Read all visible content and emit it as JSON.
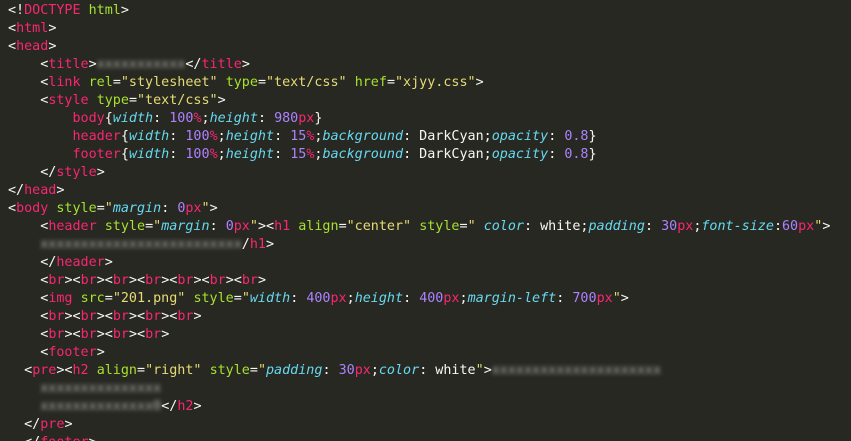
{
  "lines": [
    [
      {
        "t": "<!",
        "c": "punct"
      },
      {
        "t": "DOCTYPE",
        "c": "tag"
      },
      {
        "t": " ",
        "c": "text"
      },
      {
        "t": "html",
        "c": "attr"
      },
      {
        "t": ">",
        "c": "punct"
      }
    ],
    [
      {
        "t": "<",
        "c": "punct"
      },
      {
        "t": "html",
        "c": "tag"
      },
      {
        "t": ">",
        "c": "punct"
      }
    ],
    [
      {
        "t": "<",
        "c": "punct"
      },
      {
        "t": "head",
        "c": "tag"
      },
      {
        "t": ">",
        "c": "punct"
      }
    ],
    [
      {
        "t": "    <",
        "c": "punct"
      },
      {
        "t": "title",
        "c": "tag"
      },
      {
        "t": ">",
        "c": "punct"
      },
      {
        "t": "xxxxxxxxxxx",
        "c": "blur"
      },
      {
        "t": "</",
        "c": "punct"
      },
      {
        "t": "title",
        "c": "tag"
      },
      {
        "t": ">",
        "c": "punct"
      }
    ],
    [
      {
        "t": "    <",
        "c": "punct"
      },
      {
        "t": "link",
        "c": "tag"
      },
      {
        "t": " ",
        "c": "text"
      },
      {
        "t": "rel",
        "c": "attr"
      },
      {
        "t": "=",
        "c": "punct"
      },
      {
        "t": "\"stylesheet\"",
        "c": "string"
      },
      {
        "t": " ",
        "c": "text"
      },
      {
        "t": "type",
        "c": "attr"
      },
      {
        "t": "=",
        "c": "punct"
      },
      {
        "t": "\"text/css\"",
        "c": "string"
      },
      {
        "t": " ",
        "c": "text"
      },
      {
        "t": "href",
        "c": "attr"
      },
      {
        "t": "=",
        "c": "punct"
      },
      {
        "t": "\"xjyy.css\"",
        "c": "string"
      },
      {
        "t": ">",
        "c": "punct"
      }
    ],
    [
      {
        "t": "    <",
        "c": "punct"
      },
      {
        "t": "style",
        "c": "tag"
      },
      {
        "t": " ",
        "c": "text"
      },
      {
        "t": "type",
        "c": "attr"
      },
      {
        "t": "=",
        "c": "punct"
      },
      {
        "t": "\"text/css\"",
        "c": "string"
      },
      {
        "t": ">",
        "c": "punct"
      }
    ],
    [
      {
        "t": "        ",
        "c": "text"
      },
      {
        "t": "body",
        "c": "tag"
      },
      {
        "t": "{",
        "c": "punct"
      },
      {
        "t": "width",
        "c": "prop"
      },
      {
        "t": ": ",
        "c": "punct"
      },
      {
        "t": "100",
        "c": "num"
      },
      {
        "t": "%",
        "c": "unit"
      },
      {
        "t": ";",
        "c": "punct"
      },
      {
        "t": "height",
        "c": "prop"
      },
      {
        "t": ": ",
        "c": "punct"
      },
      {
        "t": "980",
        "c": "num"
      },
      {
        "t": "px",
        "c": "unit"
      },
      {
        "t": "}",
        "c": "punct"
      }
    ],
    [
      {
        "t": "        ",
        "c": "text"
      },
      {
        "t": "header",
        "c": "tag"
      },
      {
        "t": "{",
        "c": "punct"
      },
      {
        "t": "width",
        "c": "prop"
      },
      {
        "t": ": ",
        "c": "punct"
      },
      {
        "t": "100",
        "c": "num"
      },
      {
        "t": "%",
        "c": "unit"
      },
      {
        "t": ";",
        "c": "punct"
      },
      {
        "t": "height",
        "c": "prop"
      },
      {
        "t": ": ",
        "c": "punct"
      },
      {
        "t": "15",
        "c": "num"
      },
      {
        "t": "%",
        "c": "unit"
      },
      {
        "t": ";",
        "c": "punct"
      },
      {
        "t": "background",
        "c": "prop"
      },
      {
        "t": ": DarkCyan;",
        "c": "punct"
      },
      {
        "t": "opacity",
        "c": "prop"
      },
      {
        "t": ": ",
        "c": "punct"
      },
      {
        "t": "0.8",
        "c": "num"
      },
      {
        "t": "}",
        "c": "punct"
      }
    ],
    [
      {
        "t": "        ",
        "c": "text"
      },
      {
        "t": "footer",
        "c": "tag"
      },
      {
        "t": "{",
        "c": "punct"
      },
      {
        "t": "width",
        "c": "prop"
      },
      {
        "t": ": ",
        "c": "punct"
      },
      {
        "t": "100",
        "c": "num"
      },
      {
        "t": "%",
        "c": "unit"
      },
      {
        "t": ";",
        "c": "punct"
      },
      {
        "t": "height",
        "c": "prop"
      },
      {
        "t": ": ",
        "c": "punct"
      },
      {
        "t": "15",
        "c": "num"
      },
      {
        "t": "%",
        "c": "unit"
      },
      {
        "t": ";",
        "c": "punct"
      },
      {
        "t": "background",
        "c": "prop"
      },
      {
        "t": ": DarkCyan;",
        "c": "punct"
      },
      {
        "t": "opacity",
        "c": "prop"
      },
      {
        "t": ": ",
        "c": "punct"
      },
      {
        "t": "0.8",
        "c": "num"
      },
      {
        "t": "}",
        "c": "punct"
      }
    ],
    [
      {
        "t": "    </",
        "c": "punct"
      },
      {
        "t": "style",
        "c": "tag"
      },
      {
        "t": ">",
        "c": "punct"
      }
    ],
    [
      {
        "t": "</",
        "c": "punct"
      },
      {
        "t": "head",
        "c": "tag"
      },
      {
        "t": ">",
        "c": "punct"
      }
    ],
    [
      {
        "t": "<",
        "c": "punct"
      },
      {
        "t": "body",
        "c": "tag"
      },
      {
        "t": " ",
        "c": "text"
      },
      {
        "t": "style",
        "c": "attr"
      },
      {
        "t": "=",
        "c": "punct"
      },
      {
        "t": "\"",
        "c": "string"
      },
      {
        "t": "margin",
        "c": "prop"
      },
      {
        "t": ": ",
        "c": "punct"
      },
      {
        "t": "0",
        "c": "num"
      },
      {
        "t": "px",
        "c": "unit"
      },
      {
        "t": "\"",
        "c": "string"
      },
      {
        "t": ">",
        "c": "punct"
      }
    ],
    [
      {
        "t": "    <",
        "c": "punct"
      },
      {
        "t": "header",
        "c": "tag"
      },
      {
        "t": " ",
        "c": "text"
      },
      {
        "t": "style",
        "c": "attr"
      },
      {
        "t": "=",
        "c": "punct"
      },
      {
        "t": "\"",
        "c": "string"
      },
      {
        "t": "margin",
        "c": "prop"
      },
      {
        "t": ": ",
        "c": "punct"
      },
      {
        "t": "0",
        "c": "num"
      },
      {
        "t": "px",
        "c": "unit"
      },
      {
        "t": "\"",
        "c": "string"
      },
      {
        "t": "><",
        "c": "punct"
      },
      {
        "t": "h1",
        "c": "tag"
      },
      {
        "t": " ",
        "c": "text"
      },
      {
        "t": "align",
        "c": "attr"
      },
      {
        "t": "=",
        "c": "punct"
      },
      {
        "t": "\"center\"",
        "c": "string"
      },
      {
        "t": " ",
        "c": "text"
      },
      {
        "t": "style",
        "c": "attr"
      },
      {
        "t": "=",
        "c": "punct"
      },
      {
        "t": "\" ",
        "c": "string"
      },
      {
        "t": "color",
        "c": "prop"
      },
      {
        "t": ": white;",
        "c": "punct"
      },
      {
        "t": "padding",
        "c": "prop"
      },
      {
        "t": ": ",
        "c": "punct"
      },
      {
        "t": "30",
        "c": "num"
      },
      {
        "t": "px",
        "c": "unit"
      },
      {
        "t": ";",
        "c": "punct"
      },
      {
        "t": "font-size",
        "c": "prop"
      },
      {
        "t": ":",
        "c": "punct"
      },
      {
        "t": "60",
        "c": "num"
      },
      {
        "t": "px",
        "c": "unit"
      },
      {
        "t": "\"",
        "c": "string"
      },
      {
        "t": ">",
        "c": "punct"
      }
    ],
    [
      {
        "t": "    ",
        "c": "text"
      },
      {
        "t": "xxxxxxxxxxxxxxxxxxxxxxxxx",
        "c": "blur"
      },
      {
        "t": "/",
        "c": "punct"
      },
      {
        "t": "h1",
        "c": "tag"
      },
      {
        "t": ">",
        "c": "punct"
      }
    ],
    [
      {
        "t": "    </",
        "c": "punct"
      },
      {
        "t": "header",
        "c": "tag"
      },
      {
        "t": ">",
        "c": "punct"
      }
    ],
    [
      {
        "t": "    <",
        "c": "punct"
      },
      {
        "t": "br",
        "c": "tag"
      },
      {
        "t": "><",
        "c": "punct"
      },
      {
        "t": "br",
        "c": "tag"
      },
      {
        "t": "><",
        "c": "punct"
      },
      {
        "t": "br",
        "c": "tag"
      },
      {
        "t": "><",
        "c": "punct"
      },
      {
        "t": "br",
        "c": "tag"
      },
      {
        "t": "><",
        "c": "punct"
      },
      {
        "t": "br",
        "c": "tag"
      },
      {
        "t": "><",
        "c": "punct"
      },
      {
        "t": "br",
        "c": "tag"
      },
      {
        "t": "><",
        "c": "punct"
      },
      {
        "t": "br",
        "c": "tag"
      },
      {
        "t": ">",
        "c": "punct"
      }
    ],
    [
      {
        "t": "    <",
        "c": "punct"
      },
      {
        "t": "img",
        "c": "tag"
      },
      {
        "t": " ",
        "c": "text"
      },
      {
        "t": "src",
        "c": "attr"
      },
      {
        "t": "=",
        "c": "punct"
      },
      {
        "t": "\"201.png\"",
        "c": "string"
      },
      {
        "t": " ",
        "c": "text"
      },
      {
        "t": "style",
        "c": "attr"
      },
      {
        "t": "=",
        "c": "punct"
      },
      {
        "t": "\"",
        "c": "string"
      },
      {
        "t": "width",
        "c": "prop"
      },
      {
        "t": ": ",
        "c": "punct"
      },
      {
        "t": "400",
        "c": "num"
      },
      {
        "t": "px",
        "c": "unit"
      },
      {
        "t": ";",
        "c": "punct"
      },
      {
        "t": "height",
        "c": "prop"
      },
      {
        "t": ": ",
        "c": "punct"
      },
      {
        "t": "400",
        "c": "num"
      },
      {
        "t": "px",
        "c": "unit"
      },
      {
        "t": ";",
        "c": "punct"
      },
      {
        "t": "margin-left",
        "c": "prop"
      },
      {
        "t": ": ",
        "c": "punct"
      },
      {
        "t": "700",
        "c": "num"
      },
      {
        "t": "px",
        "c": "unit"
      },
      {
        "t": "\"",
        "c": "string"
      },
      {
        "t": ">",
        "c": "punct"
      }
    ],
    [
      {
        "t": "    <",
        "c": "punct"
      },
      {
        "t": "br",
        "c": "tag"
      },
      {
        "t": "><",
        "c": "punct"
      },
      {
        "t": "br",
        "c": "tag"
      },
      {
        "t": "><",
        "c": "punct"
      },
      {
        "t": "br",
        "c": "tag"
      },
      {
        "t": "><",
        "c": "punct"
      },
      {
        "t": "br",
        "c": "tag"
      },
      {
        "t": "><",
        "c": "punct"
      },
      {
        "t": "br",
        "c": "tag"
      },
      {
        "t": ">",
        "c": "punct"
      }
    ],
    [
      {
        "t": "    <",
        "c": "punct"
      },
      {
        "t": "br",
        "c": "tag"
      },
      {
        "t": "><",
        "c": "punct"
      },
      {
        "t": "br",
        "c": "tag"
      },
      {
        "t": "><",
        "c": "punct"
      },
      {
        "t": "br",
        "c": "tag"
      },
      {
        "t": "><",
        "c": "punct"
      },
      {
        "t": "br",
        "c": "tag"
      },
      {
        "t": ">",
        "c": "punct"
      }
    ],
    [
      {
        "t": "    <",
        "c": "punct"
      },
      {
        "t": "footer",
        "c": "tag"
      },
      {
        "t": ">",
        "c": "punct"
      }
    ],
    [
      {
        "t": "  <",
        "c": "punct"
      },
      {
        "t": "pre",
        "c": "tag"
      },
      {
        "t": "><",
        "c": "punct"
      },
      {
        "t": "h2",
        "c": "tag"
      },
      {
        "t": " ",
        "c": "text"
      },
      {
        "t": "align",
        "c": "attr"
      },
      {
        "t": "=",
        "c": "punct"
      },
      {
        "t": "\"right\"",
        "c": "string"
      },
      {
        "t": " ",
        "c": "text"
      },
      {
        "t": "style",
        "c": "attr"
      },
      {
        "t": "=",
        "c": "punct"
      },
      {
        "t": "\"",
        "c": "string"
      },
      {
        "t": "padding",
        "c": "prop"
      },
      {
        "t": ": ",
        "c": "punct"
      },
      {
        "t": "30",
        "c": "num"
      },
      {
        "t": "px",
        "c": "unit"
      },
      {
        "t": ";",
        "c": "punct"
      },
      {
        "t": "color",
        "c": "prop"
      },
      {
        "t": ": white",
        "c": "punct"
      },
      {
        "t": "\"",
        "c": "string"
      },
      {
        "t": ">",
        "c": "punct"
      },
      {
        "t": "xxxxxxxxxxxxxxxxxxxxx",
        "c": "blur"
      }
    ],
    [
      {
        "t": "    ",
        "c": "text"
      },
      {
        "t": "xxxxxxxxxxxxxxx",
        "c": "blur"
      }
    ],
    [
      {
        "t": "    ",
        "c": "text"
      },
      {
        "t": "xxxxxxxxxxxxxx0",
        "c": "blur"
      },
      {
        "t": "</",
        "c": "punct"
      },
      {
        "t": "h2",
        "c": "tag"
      },
      {
        "t": ">",
        "c": "punct"
      }
    ],
    [
      {
        "t": "  </",
        "c": "punct"
      },
      {
        "t": "pre",
        "c": "tag"
      },
      {
        "t": ">",
        "c": "punct"
      }
    ],
    [
      {
        "t": "  </",
        "c": "punct"
      },
      {
        "t": "footer",
        "c": "tag"
      },
      {
        "t": ">",
        "c": "punct"
      }
    ]
  ]
}
